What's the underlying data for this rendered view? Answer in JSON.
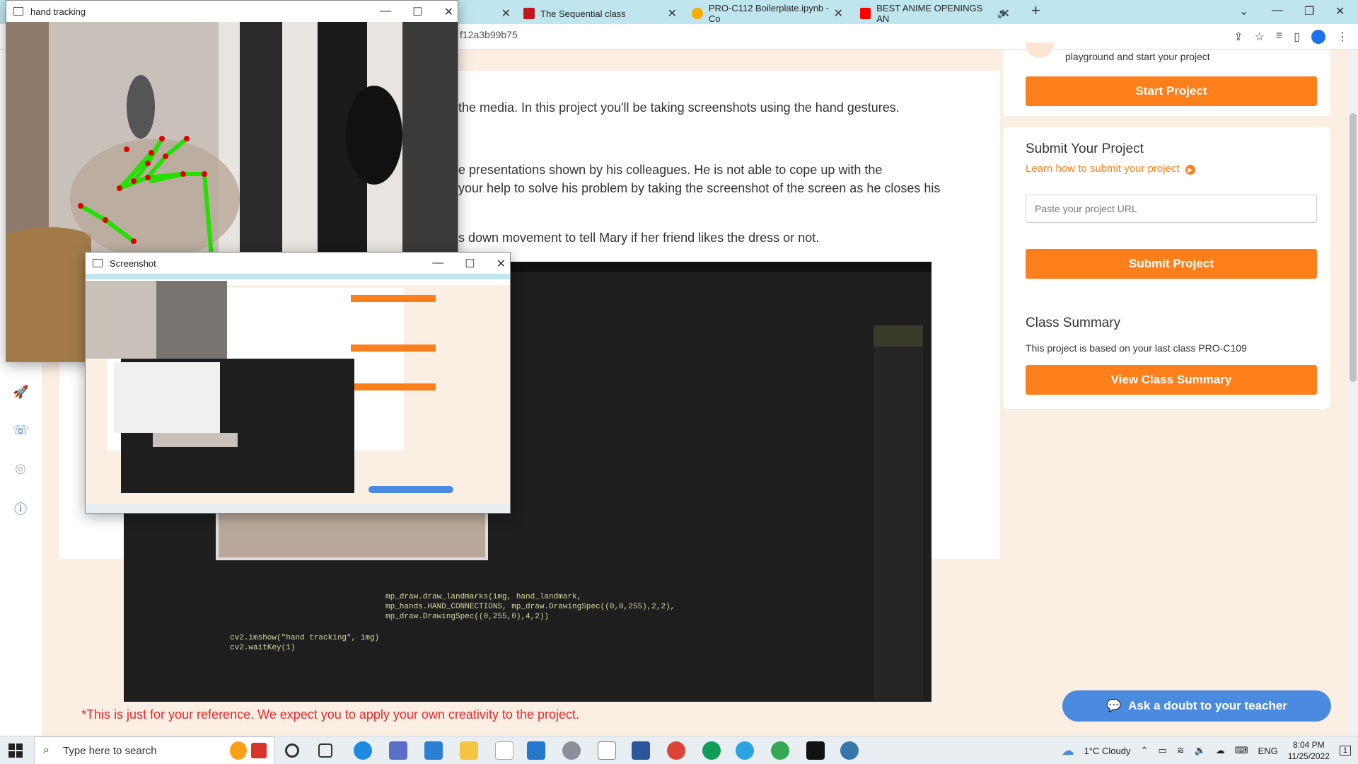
{
  "browser": {
    "tabs": [
      {
        "label": "The Sequential class",
        "fav_color": "#c4161c"
      },
      {
        "label": "PRO-C112 Boilerplate.ipynb - Co",
        "fav_color": "#f9ab00"
      },
      {
        "label": "BEST ANIME OPENINGS AN",
        "fav_color": "#ff0000"
      }
    ],
    "url_fragment": "f12a3b99b75",
    "new_tab": "+"
  },
  "page": {
    "paragraphs": [
      "the media. In this project you'll be taking screenshots using the hand gestures.",
      "e presentations shown by his colleagues. He is not able to cope up with the",
      "your help to solve his problem by taking the screenshot of the screen as he closes his",
      "s down movement to tell Mary if her friend likes the dress or not."
    ],
    "disclaimer": "*This is just for your reference. We expect you to apply your own creativity to the project.",
    "code_lines": [
      "mp_draw.draw_landmarks(img, hand_landmark,",
      "mp_hands.HAND_CONNECTIONS, mp_draw.DrawingSpec((0,0,255),2,2),",
      "mp_draw.DrawingSpec((0,255,0),4,2))",
      "cv2.imshow(\"hand tracking\", img)",
      "cv2.waitKey(1)"
    ]
  },
  "sidebar": {
    "start_card_text": "playground and start your project",
    "start_button": "Start Project",
    "submit_title": "Submit Your Project",
    "submit_link": "Learn how to submit your project",
    "url_placeholder": "Paste your project URL",
    "submit_button": "Submit Project",
    "summary_title": "Class Summary",
    "summary_text": "This project is based on your last class PRO-C109",
    "summary_button": "View Class Summary",
    "doubt_button": "Ask a doubt to your teacher"
  },
  "windows": {
    "hand_title": "hand tracking",
    "screenshot_title": "Screenshot"
  },
  "taskbar": {
    "search_placeholder": "Type here to search",
    "weather": "1°C  Cloudy",
    "language": "ENG",
    "time": "8:04 PM",
    "date": "11/25/2022",
    "notifications": "1"
  },
  "colors": {
    "accent": "#fd7f1c",
    "doubt_blue": "#4a8be0",
    "warning_red": "#e8262b",
    "landmark_green": "#22e000",
    "landmark_red": "#e00000"
  }
}
